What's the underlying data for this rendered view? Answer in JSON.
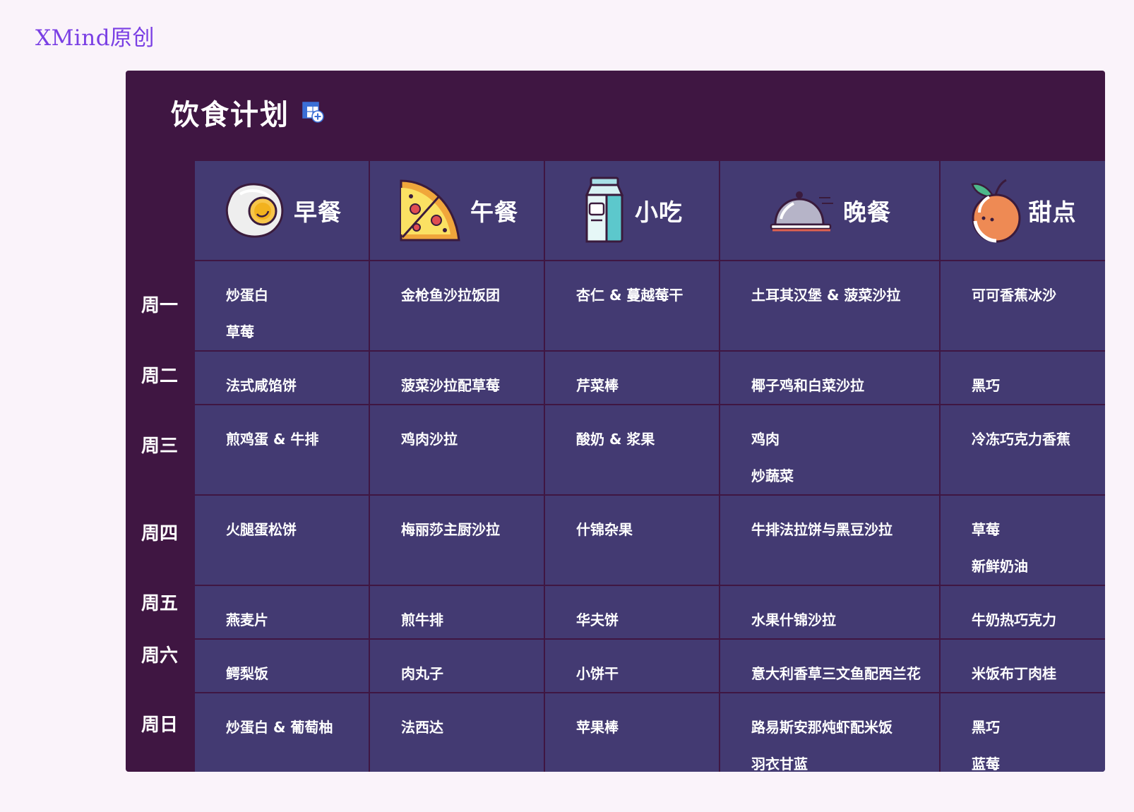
{
  "brand": "XMind原创",
  "title": "饮食计划",
  "columns": [
    {
      "label": "早餐",
      "icon": "fried-egg-icon"
    },
    {
      "label": "午餐",
      "icon": "pizza-slice-icon"
    },
    {
      "label": "小吃",
      "icon": "milk-carton-icon"
    },
    {
      "label": "晚餐",
      "icon": "food-cloche-icon"
    },
    {
      "label": "甜点",
      "icon": "orange-fruit-icon"
    }
  ],
  "rows": [
    {
      "day": "周一",
      "cells": [
        [
          "炒蛋白",
          "草莓"
        ],
        [
          "金枪鱼沙拉饭团"
        ],
        [
          "杏仁 & 蔓越莓干"
        ],
        [
          "土耳其汉堡 & 菠菜沙拉"
        ],
        [
          "可可香蕉冰沙"
        ]
      ]
    },
    {
      "day": "周二",
      "cells": [
        [
          "法式咸馅饼"
        ],
        [
          "菠菜沙拉配草莓"
        ],
        [
          "芹菜棒"
        ],
        [
          "椰子鸡和白菜沙拉"
        ],
        [
          "黑巧"
        ]
      ]
    },
    {
      "day": "周三",
      "cells": [
        [
          "煎鸡蛋 & 牛排"
        ],
        [
          "鸡肉沙拉"
        ],
        [
          "酸奶 & 浆果"
        ],
        [
          "鸡肉",
          "炒蔬菜"
        ],
        [
          "冷冻巧克力香蕉"
        ]
      ]
    },
    {
      "day": "周四",
      "cells": [
        [
          "火腿蛋松饼"
        ],
        [
          "梅丽莎主厨沙拉"
        ],
        [
          "什锦杂果"
        ],
        [
          "牛排法拉饼与黑豆沙拉"
        ],
        [
          "草莓",
          "新鲜奶油"
        ]
      ]
    },
    {
      "day": "周五",
      "cells": [
        [
          "燕麦片"
        ],
        [
          "煎牛排"
        ],
        [
          "华夫饼"
        ],
        [
          "水果什锦沙拉"
        ],
        [
          "牛奶热巧克力"
        ]
      ]
    },
    {
      "day": "周六",
      "cells": [
        [
          "鳄梨饭"
        ],
        [
          "肉丸子"
        ],
        [
          "小饼干"
        ],
        [
          "意大利香草三文鱼配西兰花"
        ],
        [
          "米饭布丁肉桂"
        ]
      ]
    },
    {
      "day": "周日",
      "cells": [
        [
          "炒蛋白 & 葡萄柚"
        ],
        [
          "法西达"
        ],
        [
          "苹果棒"
        ],
        [
          "路易斯安那炖虾配米饭",
          "羽衣甘蓝"
        ],
        [
          "黑巧",
          "蓝莓"
        ]
      ]
    }
  ],
  "colors": {
    "page_bg": "#faf3fa",
    "board_bg": "#3f1642",
    "cell_bg": "#433a72",
    "brand": "#7a3fe4",
    "text": "#ffffff"
  }
}
